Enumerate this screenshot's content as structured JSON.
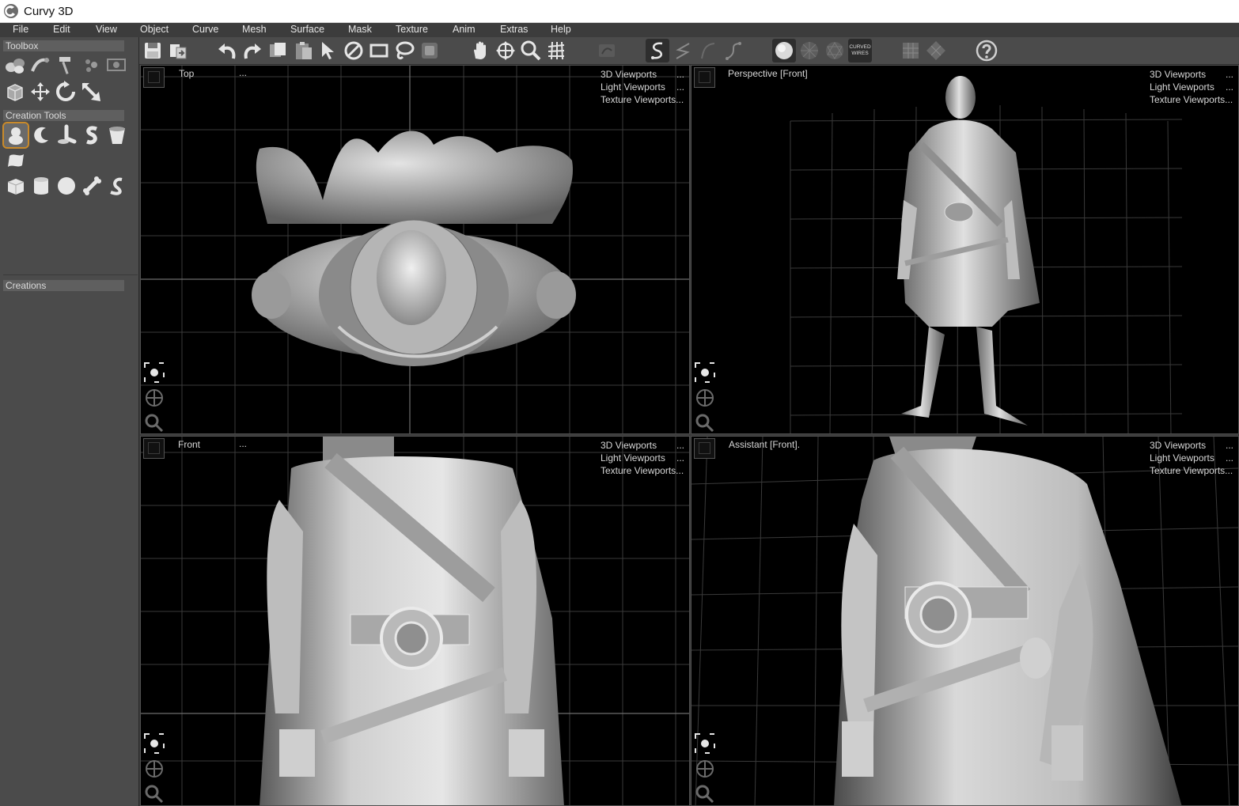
{
  "app": {
    "title": "Curvy 3D"
  },
  "menu": [
    "File",
    "Edit",
    "View",
    "Object",
    "Curve",
    "Mesh",
    "Surface",
    "Mask",
    "Texture",
    "Anim",
    "Extras",
    "Help"
  ],
  "leftpanel": {
    "toolbox_label": "Toolbox",
    "creation_tools_label": "Creation Tools",
    "creations_label": "Creations"
  },
  "toolbar": {
    "curved_wires_label_1": "CURVED",
    "curved_wires_label_2": "WIRES"
  },
  "viewports": [
    {
      "title": "Top",
      "dots": "...",
      "menu": [
        "3D Viewports",
        "Light Viewports",
        "Texture Viewports..."
      ],
      "menu_dots": [
        "...",
        "..."
      ]
    },
    {
      "title": "Perspective [Front]",
      "dots": "",
      "menu": [
        "3D Viewports",
        "Light Viewports",
        "Texture Viewports..."
      ],
      "menu_dots": [
        "...",
        "..."
      ]
    },
    {
      "title": "Front",
      "dots": "...",
      "menu": [
        "3D Viewports",
        "Light Viewports",
        "Texture Viewports..."
      ],
      "menu_dots": [
        "...",
        "..."
      ]
    },
    {
      "title": "Assistant [Front].",
      "dots": "",
      "menu": [
        "3D Viewports",
        "Light Viewports",
        "Texture Viewports..."
      ],
      "menu_dots": [
        "...",
        "..."
      ]
    }
  ],
  "colors": {
    "accent_selected": "#c98a2a",
    "viewport_bg": "#000000",
    "panel_bg": "#4b4b4b",
    "menubar_bg": "#3c3c3c"
  }
}
